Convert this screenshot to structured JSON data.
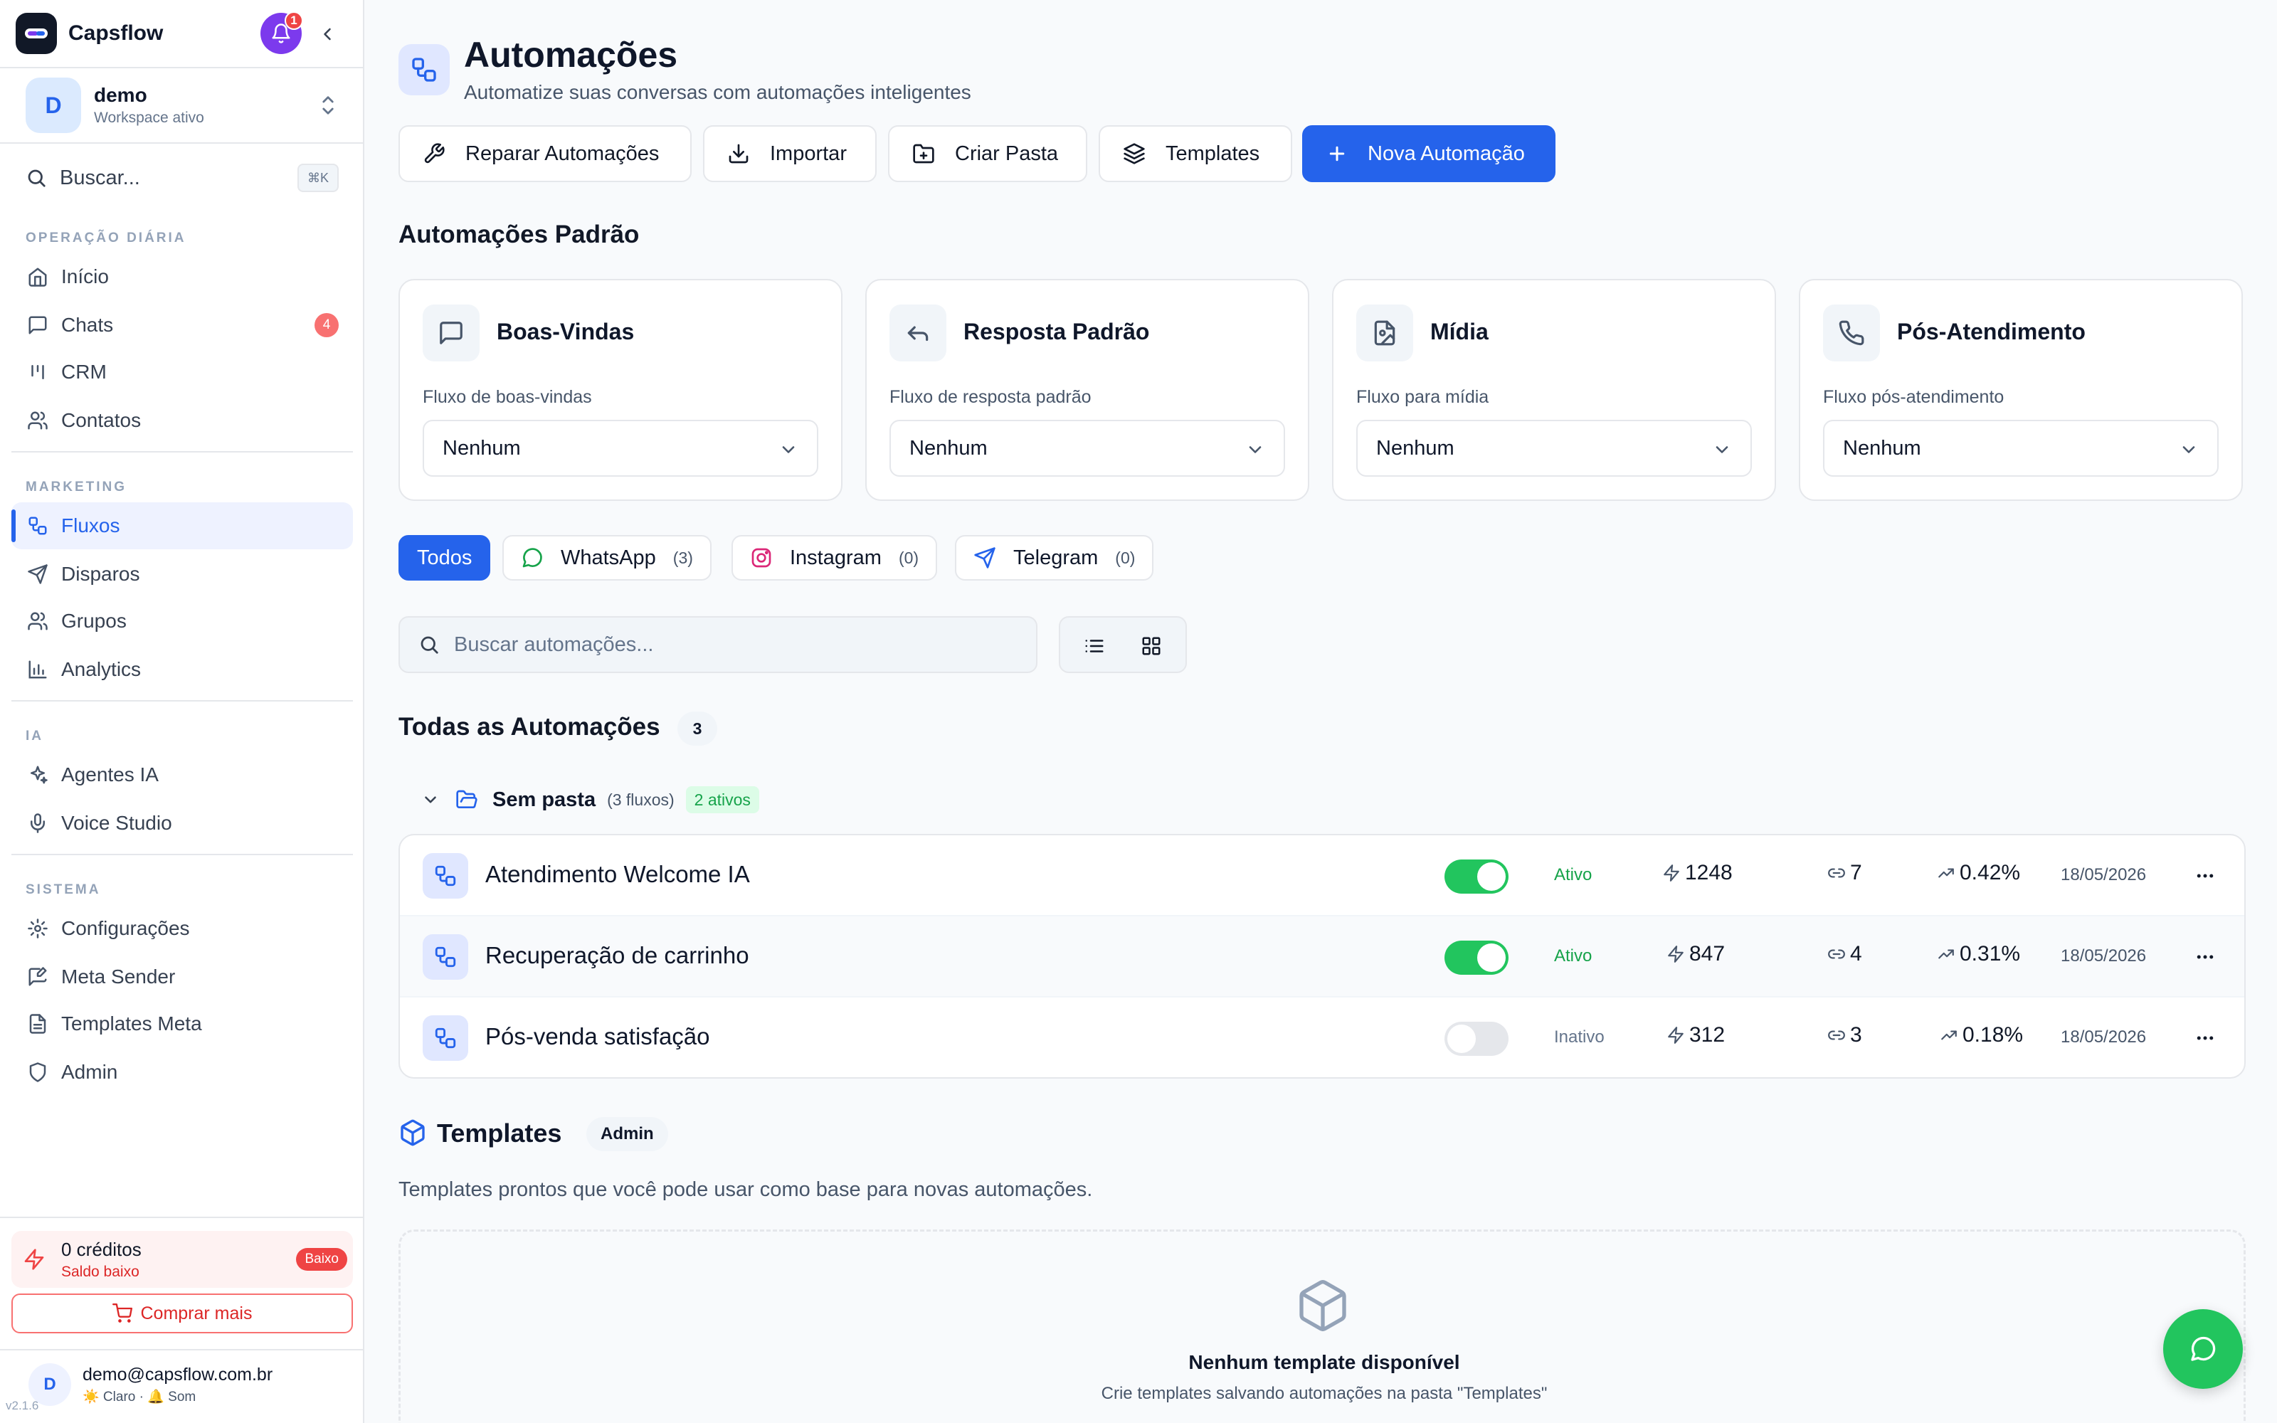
{
  "brand": {
    "name": "Capsflow",
    "notification_count": "1"
  },
  "workspace": {
    "initial": "D",
    "name": "demo",
    "subtitle": "Workspace ativo"
  },
  "sidebar_search": {
    "placeholder": "Buscar...",
    "shortcut": "⌘K"
  },
  "sections": {
    "daily": "OPERAÇÃO DIÁRIA",
    "marketing": "MARKETING",
    "ai": "IA",
    "system": "SISTEMA"
  },
  "nav": {
    "inicio": "Início",
    "chats": "Chats",
    "chats_badge": "4",
    "crm": "CRM",
    "contatos": "Contatos",
    "fluxos": "Fluxos",
    "disparos": "Disparos",
    "grupos": "Grupos",
    "analytics": "Analytics",
    "agentes": "Agentes IA",
    "voice": "Voice Studio",
    "config": "Configurações",
    "meta_sender": "Meta Sender",
    "templates_meta": "Templates Meta",
    "admin": "Admin"
  },
  "credits": {
    "amount": "0 créditos",
    "status": "Saldo baixo",
    "badge": "Baixo",
    "buy": "Comprar mais"
  },
  "user": {
    "initial": "D",
    "email": "demo@capsflow.com.br",
    "prefs": "☀️ Claro · 🔔 Som"
  },
  "version": "v2.1.6",
  "page": {
    "title": "Automações",
    "subtitle": "Automatize suas conversas com automações inteligentes"
  },
  "toolbar": {
    "repair": "Reparar Automações",
    "import": "Importar",
    "folder": "Criar Pasta",
    "templates": "Templates",
    "new": "Nova Automação"
  },
  "defaults": {
    "title": "Automações Padrão",
    "cards": [
      {
        "title": "Boas-Vindas",
        "label": "Fluxo de boas-vindas",
        "value": "Nenhum",
        "icon": "message-icon"
      },
      {
        "title": "Resposta Padrão",
        "label": "Fluxo de resposta padrão",
        "value": "Nenhum",
        "icon": "reply-icon"
      },
      {
        "title": "Mídia",
        "label": "Fluxo para mídia",
        "value": "Nenhum",
        "icon": "file-image-icon"
      },
      {
        "title": "Pós-Atendimento",
        "label": "Fluxo pós-atendimento",
        "value": "Nenhum",
        "icon": "phone-icon"
      }
    ]
  },
  "filters": {
    "all": "Todos",
    "whatsapp": "WhatsApp",
    "whatsapp_count": "(3)",
    "instagram": "Instagram",
    "instagram_count": "(0)",
    "telegram": "Telegram",
    "telegram_count": "(0)"
  },
  "main_search": {
    "placeholder": "Buscar automações..."
  },
  "all_automations": {
    "title": "Todas as Automações",
    "count": "3"
  },
  "folder": {
    "name": "Sem pasta",
    "count": "(3 fluxos)",
    "active": "2 ativos"
  },
  "automations": [
    {
      "name": "Atendimento Welcome IA",
      "active": true,
      "status": "Ativo",
      "triggers": "1248",
      "links": "7",
      "rate": "0.42%",
      "date": "18/05/2026"
    },
    {
      "name": "Recuperação de carrinho",
      "active": true,
      "status": "Ativo",
      "triggers": "847",
      "links": "4",
      "rate": "0.31%",
      "date": "18/05/2026"
    },
    {
      "name": "Pós-venda satisfação",
      "active": false,
      "status": "Inativo",
      "triggers": "312",
      "links": "3",
      "rate": "0.18%",
      "date": "18/05/2026"
    }
  ],
  "templates": {
    "title": "Templates",
    "badge": "Admin",
    "description": "Templates prontos que você pode usar como base para novas automações.",
    "empty_title": "Nenhum template disponível",
    "empty_sub": "Crie templates salvando automações na pasta \"Templates\""
  },
  "colors": {
    "primary": "#2563eb",
    "success": "#22c55e",
    "danger": "#ef4444",
    "brand_bell": "#7c3aed"
  }
}
